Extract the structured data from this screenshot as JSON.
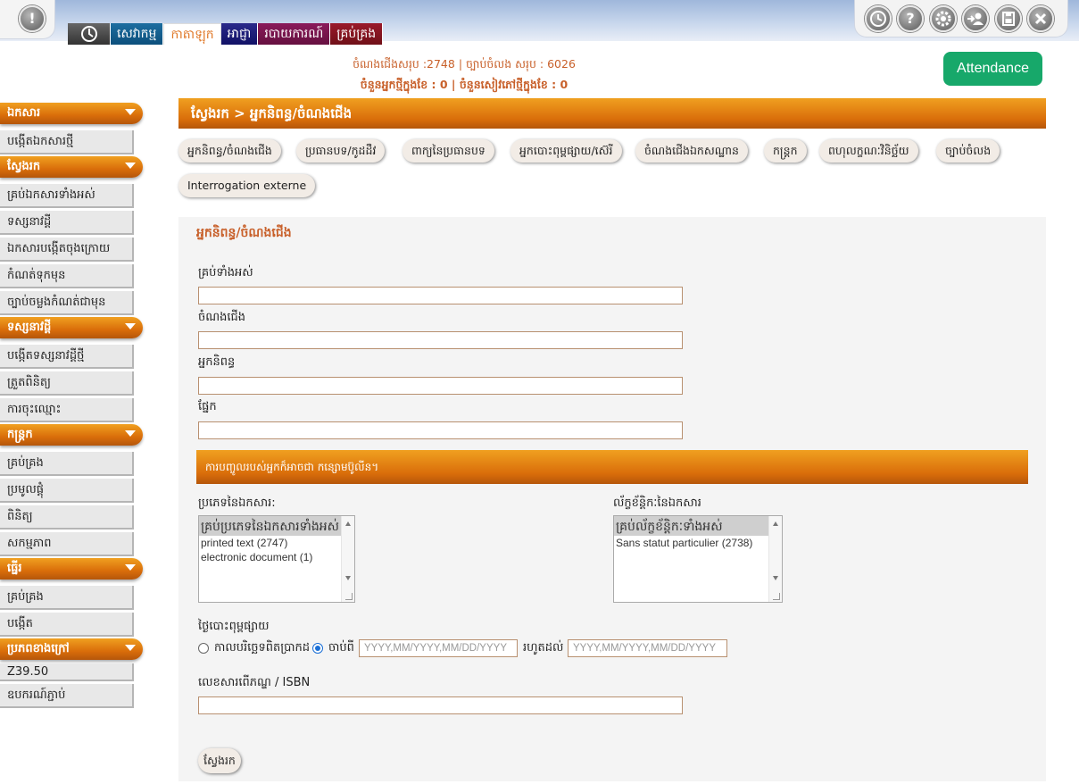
{
  "top_icons": {
    "logo": "info-icon",
    "tools": [
      "clock-icon",
      "help-icon",
      "settings-icon",
      "user-switch-icon",
      "save-icon",
      "close-icon"
    ]
  },
  "tabs": [
    {
      "label": ""
    },
    {
      "label": "សេវាកម្ម"
    },
    {
      "label": "កាតាឡុក"
    },
    {
      "label": "អាជ្ញា"
    },
    {
      "label": "របាយការណ៍"
    },
    {
      "label": "គ្រប់គ្រង"
    }
  ],
  "stats": {
    "line1": "ចំណងជើងសរុប :2748 | ច្បាប់ចំលង សរុប : 6026",
    "line2": "ចំនួនអ្នកថ្មីក្នុងខែ : 0 | ចំនួនសៀវភៅថ្មីក្នុងខែ : 0"
  },
  "attendance_label": "Attendance",
  "sidebar": [
    {
      "title": "ឯកសារ",
      "items": [
        "បង្កើតឯកសារថ្មី"
      ]
    },
    {
      "title": "ស្វែងរក",
      "items": [
        "គ្រប់ឯកសារទាំងអស់",
        "ទស្សនាវដ្ដី",
        "ឯកសារបង្កើតចុងក្រោយ",
        "កំណត់ទុកមុន",
        "ច្បាប់ចម្លងកំណត់ជាមុន"
      ]
    },
    {
      "title": "ទស្សនាវដ្ដី",
      "items": [
        "បង្កើតទស្សនាវដ្ដីថ្មី",
        "ត្រួតពិនិត្យ",
        "ការចុះឈ្មោះ"
      ]
    },
    {
      "title": "កន្ត្រក",
      "items": [
        "គ្រប់គ្រង",
        "ប្រមូលផ្ដុំ",
        "ពិនិត្យ",
        "សកម្មភាព"
      ]
    },
    {
      "title": "ធ្នើរ",
      "items": [
        "គ្រប់គ្រង",
        "បង្កើត"
      ]
    },
    {
      "title": "ប្រភពខាងក្រៅ",
      "items": [
        "Z39.50",
        "ឧបករណ៍ភ្ជាប់"
      ]
    }
  ],
  "breadcrumb": "ស្វែងរក > អ្នកនិពន្ធ/ចំណងជើង",
  "search_tabs": [
    "អ្នកនិពន្ធ/ចំណងជើង",
    "ប្រធានបទ/កូដដឺវ",
    "ពាក្យនៃប្រធានបទ",
    "អ្នកបោះពុម្ពផ្សាយ/ស៊េរី",
    "ចំណងជើងឯកសណ្ឋាន",
    "កន្ត្រក",
    "ពហុលក្ខណៈវិនិច្ឆ័យ",
    "ច្បាប់ចំលង",
    "Interrogation externe"
  ],
  "form": {
    "title": "អ្នកនិពន្ធ/ចំណងជើង",
    "all_label": "គ្រប់ទាំងអស់",
    "title_label": "ចំណងជើង",
    "author_label": "អ្នកនិពន្ធ",
    "section_label": "ផ្នែក",
    "info_text": "ការបញ្ចូលរបស់អ្នកក៏អាចជា កន្សោមប៊ូលីន។",
    "doc_type_label": "ប្រភេទនៃឯកសារ:",
    "doc_type_options": [
      "គ្រប់ប្រភេទនៃឯកសារទាំងអស់",
      "printed text (2747)",
      "electronic document (1)"
    ],
    "doc_status_label": "ល័ក្ខខ័ន្តិកៈនៃឯកសារ",
    "doc_status_options": [
      "គ្រប់ល័ក្ខខ័ន្តិកៈទាំងអស់",
      "Sans statut particulier (2738)"
    ],
    "pub_date_label": "ថ្ងៃបោះពុម្ពផ្សាយ",
    "radio_exact_label": "កាលបរិច្ឆេទពិតប្រាកដ",
    "radio_from_label": "ចាប់ពី",
    "date_from_placeholder": "YYYY,MM/YYYY,MM/DD/YYYY",
    "date_to_label": "រហូតដល់",
    "date_to_placeholder": "YYYY,MM/YYYY,MM/DD/YYYY",
    "isbn_label": "លេខសារពើភណ្ឌ / ISBN",
    "search_button": "ស្វែងរក"
  }
}
